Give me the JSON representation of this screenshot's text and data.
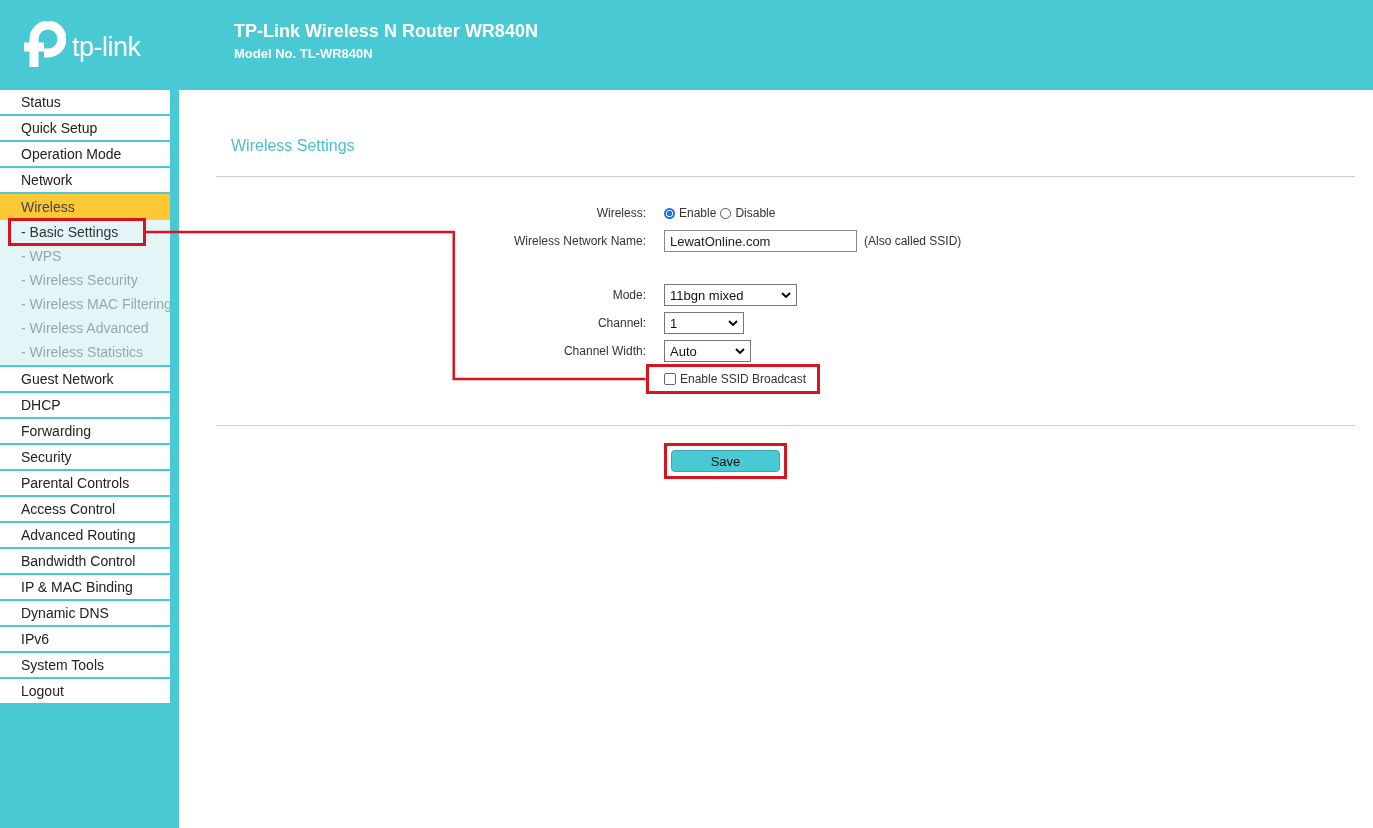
{
  "header": {
    "logo_text": "tp-link",
    "title": "TP-Link Wireless N Router WR840N",
    "model": "Model No. TL-WR840N"
  },
  "menu": [
    {
      "label": "Status",
      "selected": false
    },
    {
      "label": "Quick Setup",
      "selected": false
    },
    {
      "label": "Operation Mode",
      "selected": false
    },
    {
      "label": "Network",
      "selected": false
    },
    {
      "label": "Wireless",
      "selected": true,
      "children": [
        {
          "label": "- Basic Settings",
          "selected": true,
          "highlighted": true
        },
        {
          "label": "- WPS",
          "selected": false,
          "highlighted": false
        },
        {
          "label": "- Wireless Security",
          "selected": false,
          "highlighted": false
        },
        {
          "label": "- Wireless MAC Filtering",
          "selected": false,
          "highlighted": false
        },
        {
          "label": "- Wireless Advanced",
          "selected": false,
          "highlighted": false
        },
        {
          "label": "- Wireless Statistics",
          "selected": false,
          "highlighted": false
        }
      ]
    },
    {
      "label": "Guest Network",
      "selected": false
    },
    {
      "label": "DHCP",
      "selected": false
    },
    {
      "label": "Forwarding",
      "selected": false
    },
    {
      "label": "Security",
      "selected": false
    },
    {
      "label": "Parental Controls",
      "selected": false
    },
    {
      "label": "Access Control",
      "selected": false
    },
    {
      "label": "Advanced Routing",
      "selected": false
    },
    {
      "label": "Bandwidth Control",
      "selected": false
    },
    {
      "label": "IP & MAC Binding",
      "selected": false
    },
    {
      "label": "Dynamic DNS",
      "selected": false
    },
    {
      "label": "IPv6",
      "selected": false
    },
    {
      "label": "System Tools",
      "selected": false
    },
    {
      "label": "Logout",
      "selected": false
    }
  ],
  "page_title": "Wireless Settings",
  "form": [
    {
      "kind": "radio",
      "label": "Wireless:",
      "options": [
        {
          "label": "Enable",
          "selected": true
        },
        {
          "label": "Disable",
          "selected": false
        }
      ]
    },
    {
      "kind": "text",
      "label": "Wireless Network Name:",
      "value": "LewatOnline.com",
      "note": "(Also called SSID)"
    },
    {
      "kind": "spacer"
    },
    {
      "kind": "select",
      "label": "Mode:",
      "value": "11bgn mixed"
    },
    {
      "kind": "select",
      "label": "Channel:",
      "value": "1"
    },
    {
      "kind": "select",
      "label": "Channel Width:",
      "value": "Auto"
    },
    {
      "kind": "checkbox",
      "label": "Enable SSID Broadcast",
      "checked": false,
      "highlighted": true
    }
  ],
  "save": {
    "label": "Save",
    "highlighted": true
  }
}
